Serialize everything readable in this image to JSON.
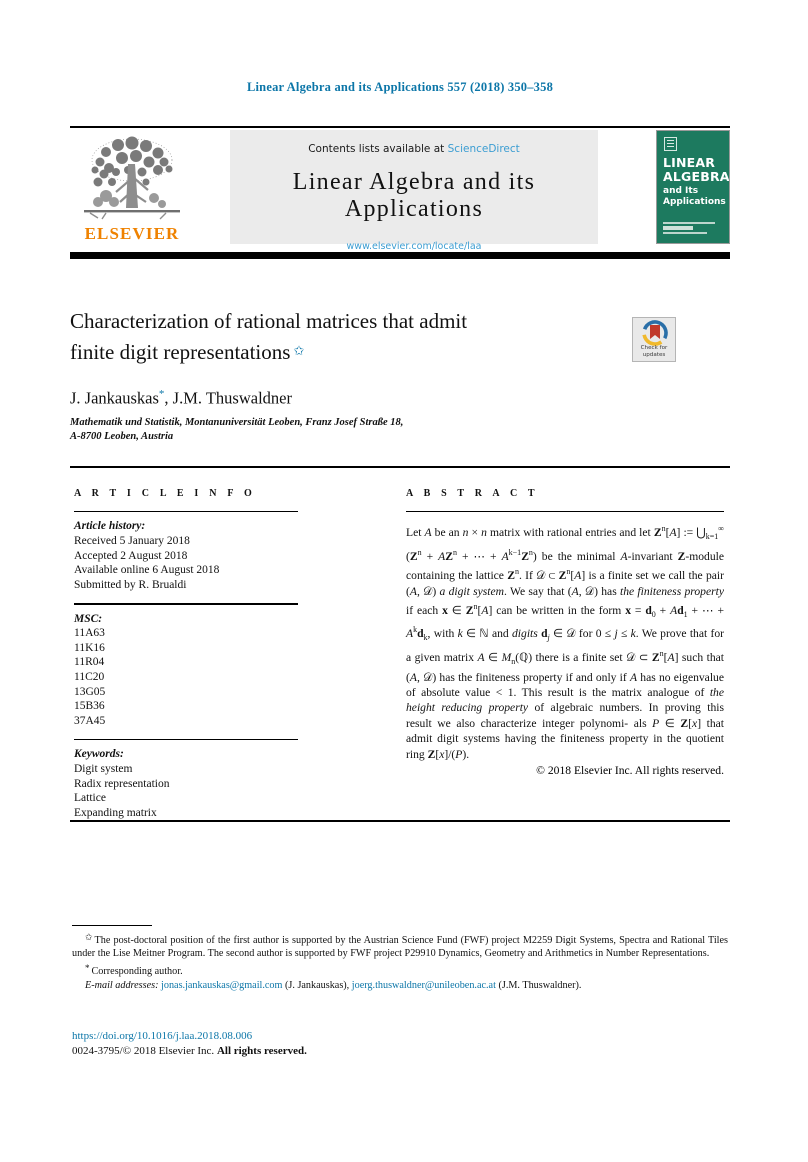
{
  "running_head": "Linear Algebra and its Applications 557 (2018) 350–358",
  "masthead": {
    "contents_prefix": "Contents lists available at ",
    "sciencedirect": "ScienceDirect",
    "journal_title": "Linear Algebra and its Applications",
    "journal_url": "www.elsevier.com/locate/laa",
    "publisher": "ELSEVIER",
    "cover": {
      "line1": "LINEAR",
      "line2": "ALGEBRA",
      "line3": "and Its",
      "line4": "Applications"
    }
  },
  "article": {
    "title_line1": "Characterization of rational matrices that admit",
    "title_line2": "finite digit representations",
    "title_footnote_marker": "✩",
    "authors": "J. Jankauskas",
    "author_marker": "*",
    "authors_rest": ", J.M. Thuswaldner",
    "affiliation_line1": "Mathematik und Statistik, Montanuniversität Leoben, Franz Josef Straße 18,",
    "affiliation_line2": "A-8700 Leoben, Austria",
    "crossmark_label_line1": "Check for",
    "crossmark_label_line2": "updates"
  },
  "info": {
    "heading": "A R T I C L E   I N F O",
    "history_label": "Article history:",
    "history": [
      "Received 5 January 2018",
      "Accepted 2 August 2018",
      "Available online 6 August 2018",
      "Submitted by R. Brualdi"
    ],
    "msc_label": "MSC:",
    "msc": [
      "11A63",
      "11K16",
      "11R04",
      "11C20",
      "13G05",
      "15B36",
      "37A45"
    ],
    "keywords_label": "Keywords:",
    "keywords": [
      "Digit system",
      "Radix representation",
      "Lattice",
      "Expanding matrix"
    ]
  },
  "abstract": {
    "heading": "A B S T R A C T",
    "copyright": "© 2018 Elsevier Inc. All rights reserved."
  },
  "footnotes": {
    "funding_marker": "✩",
    "funding": "The post-doctoral position of the first author is supported by the Austrian Science Fund (FWF) project M2259 Digit Systems, Spectra and Rational Tiles under the Lise Meitner Program. The second author is supported by FWF project P29910 Dynamics, Geometry and Arithmetics in Number Representations.",
    "corresponding_marker": "*",
    "corresponding": "Corresponding author.",
    "email_label": "E-mail addresses:",
    "email1": "jonas.jankauskas@gmail.com",
    "email1_owner": "(J. Jankauskas),",
    "email2": "joerg.thuswaldner@unileoben.ac.at",
    "email2_owner": "(J.M. Thuswaldner)."
  },
  "footer": {
    "doi": "https://doi.org/10.1016/j.laa.2018.08.006",
    "issn_prefix": "0024-3795/",
    "issn_copyright": "© 2018 Elsevier Inc.",
    "rights": "All rights reserved."
  },
  "colors": {
    "link": "#0c76a8",
    "sciencedirect": "#3b9dd2",
    "elsevier_orange": "#ef8200",
    "cover_green": "#1d7a5f"
  }
}
